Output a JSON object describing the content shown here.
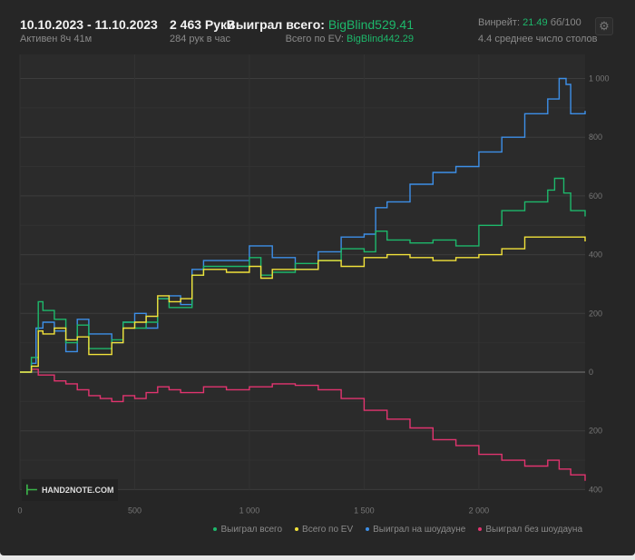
{
  "header": {
    "date_range": "10.10.2023 - 11.10.2023",
    "active": "Активен 8ч 41м",
    "hands": "2 463 Руки",
    "hands_per_hour": "284 рук в час",
    "won_total_label": "Выиграл всего:",
    "won_total_value": "BigBlind529.41",
    "ev_label": "Всего по EV:",
    "ev_value": "BigBlind442.29",
    "winrate_label": "Винрейт:",
    "winrate_value": "21.49",
    "winrate_unit": "бб/100",
    "tables": "4.4 среднее число столов",
    "settings_icon": "gear-icon"
  },
  "logo_text": "HAND2NOTE.COM",
  "chart_data": {
    "type": "line",
    "title": "",
    "xlabel": "",
    "ylabel": "",
    "xlim": [
      0,
      2463
    ],
    "ylim": [
      -400,
      1050
    ],
    "grid": true,
    "legend": "bottom-right",
    "x_ticks": [
      {
        "v": 0,
        "label": "0"
      },
      {
        "v": 500,
        "label": "500"
      },
      {
        "v": 1000,
        "label": "1 000"
      },
      {
        "v": 1500,
        "label": "1 500"
      },
      {
        "v": 2000,
        "label": "2 000"
      }
    ],
    "y_ticks": [
      {
        "v": 1000,
        "label": "1 000"
      },
      {
        "v": 800,
        "label": "800"
      },
      {
        "v": 600,
        "label": "600"
      },
      {
        "v": 400,
        "label": "400"
      },
      {
        "v": 200,
        "label": "200"
      },
      {
        "v": 0,
        "label": "0"
      },
      {
        "v": -200,
        "label": "200"
      },
      {
        "v": -400,
        "label": "400"
      }
    ],
    "series": [
      {
        "name": "Выиграл на шоудауне",
        "color": "#3d8fe8",
        "x": [
          0,
          50,
          70,
          100,
          150,
          200,
          250,
          300,
          400,
          450,
          500,
          550,
          600,
          650,
          700,
          750,
          800,
          900,
          1000,
          1100,
          1200,
          1300,
          1400,
          1500,
          1550,
          1600,
          1700,
          1800,
          1900,
          2000,
          2100,
          2200,
          2300,
          2350,
          2380,
          2400,
          2463
        ],
        "y": [
          0,
          30,
          150,
          170,
          140,
          70,
          180,
          130,
          100,
          170,
          200,
          150,
          250,
          260,
          230,
          350,
          380,
          380,
          430,
          390,
          350,
          410,
          460,
          470,
          560,
          580,
          640,
          680,
          700,
          750,
          800,
          880,
          930,
          1000,
          980,
          880,
          890
        ]
      },
      {
        "name": "Выиграл всего",
        "color": "#1db86b",
        "x": [
          0,
          50,
          80,
          100,
          150,
          200,
          250,
          300,
          400,
          450,
          500,
          550,
          600,
          650,
          700,
          750,
          800,
          900,
          1000,
          1050,
          1100,
          1200,
          1300,
          1400,
          1500,
          1550,
          1600,
          1700,
          1800,
          1900,
          2000,
          2100,
          2200,
          2300,
          2330,
          2370,
          2400,
          2463
        ],
        "y": [
          0,
          50,
          240,
          210,
          180,
          100,
          160,
          80,
          110,
          170,
          150,
          170,
          250,
          220,
          220,
          330,
          360,
          360,
          390,
          330,
          340,
          370,
          380,
          420,
          410,
          480,
          450,
          440,
          450,
          430,
          500,
          550,
          580,
          620,
          660,
          610,
          550,
          530
        ]
      },
      {
        "name": "Всего по EV",
        "color": "#f2e23a",
        "x": [
          0,
          50,
          80,
          100,
          150,
          200,
          250,
          300,
          400,
          450,
          500,
          550,
          600,
          650,
          700,
          750,
          800,
          900,
          1000,
          1050,
          1100,
          1200,
          1300,
          1400,
          1500,
          1600,
          1700,
          1800,
          1900,
          2000,
          2100,
          2200,
          2300,
          2400,
          2463
        ],
        "y": [
          0,
          20,
          140,
          130,
          150,
          110,
          120,
          60,
          100,
          150,
          170,
          190,
          260,
          240,
          250,
          330,
          350,
          340,
          360,
          320,
          350,
          350,
          380,
          360,
          390,
          400,
          390,
          380,
          390,
          400,
          420,
          460,
          460,
          460,
          445
        ]
      },
      {
        "name": "Выиграл без шоудауна",
        "color": "#e2346f",
        "x": [
          0,
          50,
          80,
          150,
          200,
          250,
          300,
          350,
          400,
          450,
          500,
          550,
          600,
          650,
          700,
          800,
          900,
          1000,
          1100,
          1200,
          1300,
          1400,
          1500,
          1600,
          1700,
          1800,
          1900,
          2000,
          2100,
          2200,
          2300,
          2350,
          2400,
          2463
        ],
        "y": [
          0,
          10,
          -10,
          -30,
          -40,
          -60,
          -80,
          -90,
          -100,
          -80,
          -90,
          -70,
          -50,
          -60,
          -70,
          -50,
          -60,
          -50,
          -40,
          -45,
          -60,
          -90,
          -130,
          -160,
          -190,
          -230,
          -250,
          -280,
          -300,
          -320,
          -300,
          -330,
          -350,
          -370
        ]
      }
    ]
  }
}
